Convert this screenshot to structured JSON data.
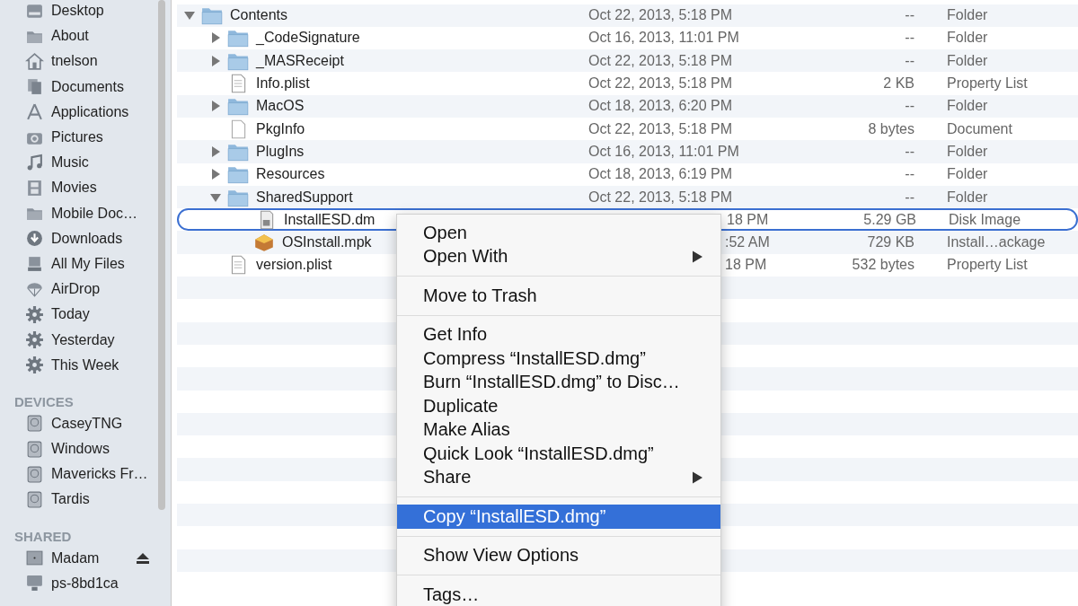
{
  "sidebar": {
    "sections": [
      {
        "items": [
          {
            "label": "Desktop",
            "selected": false
          },
          {
            "label": "About",
            "selected": false
          },
          {
            "label": "tnelson",
            "selected": false
          },
          {
            "label": "Documents",
            "selected": false
          },
          {
            "label": "Applications",
            "selected": false
          },
          {
            "label": "Pictures",
            "selected": false
          },
          {
            "label": "Music",
            "selected": false
          },
          {
            "label": "Movies",
            "selected": false
          },
          {
            "label": "Mobile Doc…",
            "selected": false
          },
          {
            "label": "Downloads",
            "selected": false
          },
          {
            "label": "All My Files",
            "selected": false
          },
          {
            "label": "AirDrop",
            "selected": false
          },
          {
            "label": "Today",
            "selected": false
          },
          {
            "label": "Yesterday",
            "selected": false
          },
          {
            "label": "This Week",
            "selected": false
          }
        ]
      },
      {
        "title": "DEVICES",
        "items": [
          {
            "label": "CaseyTNG",
            "selected": false
          },
          {
            "label": "Windows",
            "selected": false
          },
          {
            "label": "Mavericks Fr…",
            "selected": false
          },
          {
            "label": "Tardis",
            "selected": false
          }
        ]
      },
      {
        "title": "SHARED",
        "items": [
          {
            "label": "Madam",
            "selected": false,
            "ejectable": true
          },
          {
            "label": "ps-8bd1ca",
            "selected": false,
            "ejectable": false
          }
        ]
      }
    ]
  },
  "files": [
    {
      "name": "Contents",
      "kind": "folder",
      "date": "Oct 22, 2013, 5:18 PM",
      "size": "--",
      "kind_label": "Folder",
      "expanded": true,
      "selected": false,
      "children": [
        {
          "name": "_CodeSignature",
          "kind": "folder",
          "date": "Oct 16, 2013, 11:01 PM",
          "size": "--",
          "kind_label": "Folder",
          "expanded": false,
          "selected": false
        },
        {
          "name": "_MASReceipt",
          "kind": "folder",
          "date": "Oct 22, 2013, 5:18 PM",
          "size": "--",
          "kind_label": "Folder",
          "expanded": false,
          "selected": false
        },
        {
          "name": "Info.plist",
          "kind": "plist",
          "date": "Oct 22, 2013, 5:18 PM",
          "size": "2 KB",
          "kind_label": "Property List",
          "selected": false
        },
        {
          "name": "MacOS",
          "kind": "folder",
          "date": "Oct 18, 2013, 6:20 PM",
          "size": "--",
          "kind_label": "Folder",
          "expanded": false,
          "selected": false
        },
        {
          "name": "PkgInfo",
          "kind": "blank",
          "date": "Oct 22, 2013, 5:18 PM",
          "size": "8 bytes",
          "kind_label": "Document",
          "selected": false
        },
        {
          "name": "PlugIns",
          "kind": "folder",
          "date": "Oct 16, 2013, 11:01 PM",
          "size": "--",
          "kind_label": "Folder",
          "expanded": false,
          "selected": false
        },
        {
          "name": "Resources",
          "kind": "folder",
          "date": "Oct 18, 2013, 6:19 PM",
          "size": "--",
          "kind_label": "Folder",
          "expanded": false,
          "selected": false
        },
        {
          "name": "SharedSupport",
          "kind": "folder",
          "date": "Oct 22, 2013, 5:18 PM",
          "size": "--",
          "kind_label": "Folder",
          "expanded": true,
          "selected": false,
          "children": [
            {
              "name": "InstallESD.dm",
              "kind": "diskimage",
              "date": "18 PM",
              "size": "5.29 GB",
              "kind_label": "Disk Image",
              "selected": true
            },
            {
              "name": "OSInstall.mpk",
              "kind": "package",
              "date": ":52 AM",
              "size": "729 KB",
              "kind_label": "Install…ackage",
              "selected": false
            }
          ]
        },
        {
          "name": "version.plist",
          "kind": "plist",
          "date": "18 PM",
          "size": "532 bytes",
          "kind_label": "Property List",
          "selected": false
        }
      ]
    }
  ],
  "context_menu": {
    "groups": [
      [
        {
          "label": "Open",
          "submenu": false,
          "selected": false
        },
        {
          "label": "Open With",
          "submenu": true,
          "selected": false
        }
      ],
      [
        {
          "label": "Move to Trash",
          "submenu": false,
          "selected": false
        }
      ],
      [
        {
          "label": "Get Info",
          "submenu": false,
          "selected": false
        },
        {
          "label": "Compress “InstallESD.dmg”",
          "submenu": false,
          "selected": false
        },
        {
          "label": "Burn “InstallESD.dmg” to Disc…",
          "submenu": false,
          "selected": false
        },
        {
          "label": "Duplicate",
          "submenu": false,
          "selected": false
        },
        {
          "label": "Make Alias",
          "submenu": false,
          "selected": false
        },
        {
          "label": "Quick Look “InstallESD.dmg”",
          "submenu": false,
          "selected": false
        },
        {
          "label": "Share",
          "submenu": true,
          "selected": false
        }
      ],
      [
        {
          "label": "Copy “InstallESD.dmg”",
          "submenu": false,
          "selected": true
        }
      ],
      [
        {
          "label": "Show View Options",
          "submenu": false,
          "selected": false
        }
      ],
      [
        {
          "label": "Tags…",
          "submenu": false,
          "selected": false
        }
      ]
    ]
  }
}
